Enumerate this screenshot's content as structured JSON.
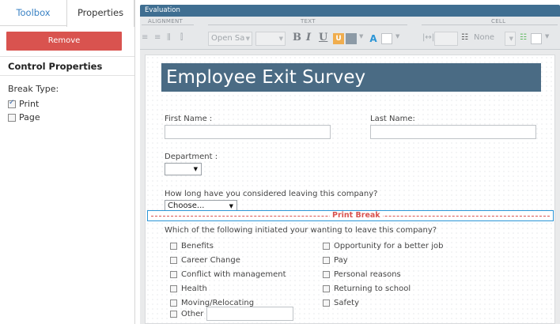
{
  "left_panel": {
    "tabs": [
      {
        "label": "Toolbox",
        "active": false
      },
      {
        "label": "Properties",
        "active": true
      }
    ],
    "remove_label": "Remove",
    "section_title": "Control Properties",
    "break_type_label": "Break Type:",
    "break_options": [
      {
        "label": "Print",
        "checked": true
      },
      {
        "label": "Page",
        "checked": false
      }
    ]
  },
  "editor": {
    "title": "Evaluation",
    "ribbon": {
      "groups": [
        "ALIGNMENT",
        "TEXT",
        "CELL"
      ],
      "font_value": "Open Sa",
      "bold": "B",
      "italic": "I",
      "underline": "U",
      "cell_style_value": "None"
    },
    "colors": {
      "banner": "#4a6b84",
      "titlebar": "#3f6e91",
      "remove": "#d9534f",
      "print_break": "#d9534f",
      "selection": "#2b95d6"
    }
  },
  "form": {
    "heading": "Employee Exit Survey",
    "first_name_label": "First Name :",
    "last_name_label": "Last Name:",
    "department_label": "Department :",
    "how_long_label": "How long have you considered leaving this company?",
    "how_long_value": "Choose...",
    "print_break_label": "Print Break",
    "initiated_label": "Which of the following initiated your wanting to leave this company?",
    "reasons_left": [
      "Benefits",
      "Career Change",
      "Conflict with management",
      "Health",
      "Moving/Relocating",
      "Other"
    ],
    "reasons_right": [
      "Opportunity for a better job",
      "Pay",
      "Personal reasons",
      "Returning to school",
      "Safety"
    ]
  }
}
